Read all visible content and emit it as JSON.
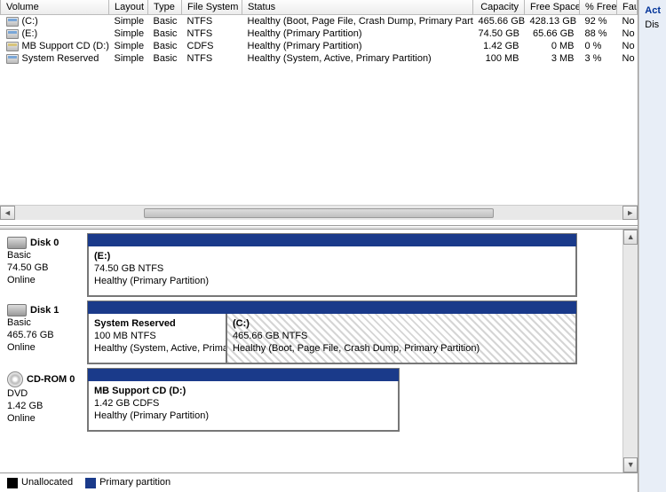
{
  "columns": {
    "volume": "Volume",
    "layout": "Layout",
    "type": "Type",
    "filesystem": "File System",
    "status": "Status",
    "capacity": "Capacity",
    "freespace": "Free Space",
    "pctfree": "% Free",
    "fault": "Fault"
  },
  "volumes": [
    {
      "icon": "hdd",
      "name": "(C:)",
      "layout": "Simple",
      "type": "Basic",
      "fs": "NTFS",
      "status": "Healthy (Boot, Page File, Crash Dump, Primary Partition)",
      "capacity": "465.66 GB",
      "free": "428.13 GB",
      "pct": "92 %",
      "fault": "No"
    },
    {
      "icon": "hdd",
      "name": "(E:)",
      "layout": "Simple",
      "type": "Basic",
      "fs": "NTFS",
      "status": "Healthy (Primary Partition)",
      "capacity": "74.50 GB",
      "free": "65.66 GB",
      "pct": "88 %",
      "fault": "No"
    },
    {
      "icon": "cd",
      "name": "MB Support CD (D:)",
      "layout": "Simple",
      "type": "Basic",
      "fs": "CDFS",
      "status": "Healthy (Primary Partition)",
      "capacity": "1.42 GB",
      "free": "0 MB",
      "pct": "0 %",
      "fault": "No"
    },
    {
      "icon": "hdd",
      "name": "System Reserved",
      "layout": "Simple",
      "type": "Basic",
      "fs": "NTFS",
      "status": "Healthy (System, Active, Primary Partition)",
      "capacity": "100 MB",
      "free": "3 MB",
      "pct": "3 %",
      "fault": "No"
    }
  ],
  "disks": {
    "d0": {
      "name": "Disk 0",
      "type": "Basic",
      "size": "74.50 GB",
      "state": "Online",
      "p0": {
        "name": "(E:)",
        "detail": "74.50 GB NTFS",
        "status": "Healthy (Primary Partition)"
      }
    },
    "d1": {
      "name": "Disk 1",
      "type": "Basic",
      "size": "465.76 GB",
      "state": "Online",
      "p0": {
        "name": "System Reserved",
        "detail": "100 MB NTFS",
        "status": "Healthy (System, Active, Primar"
      },
      "p1": {
        "name": "(C:)",
        "detail": "465.66 GB NTFS",
        "status": "Healthy (Boot, Page File, Crash Dump, Primary Partition)"
      }
    },
    "d2": {
      "name": "CD-ROM 0",
      "type": "DVD",
      "size": "1.42 GB",
      "state": "Online",
      "p0": {
        "name": "MB Support CD  (D:)",
        "detail": "1.42 GB CDFS",
        "status": "Healthy (Primary Partition)"
      }
    }
  },
  "legend": {
    "unallocated": "Unallocated",
    "primary": "Primary partition"
  },
  "side": {
    "actions": "Act",
    "disk": "Dis"
  }
}
